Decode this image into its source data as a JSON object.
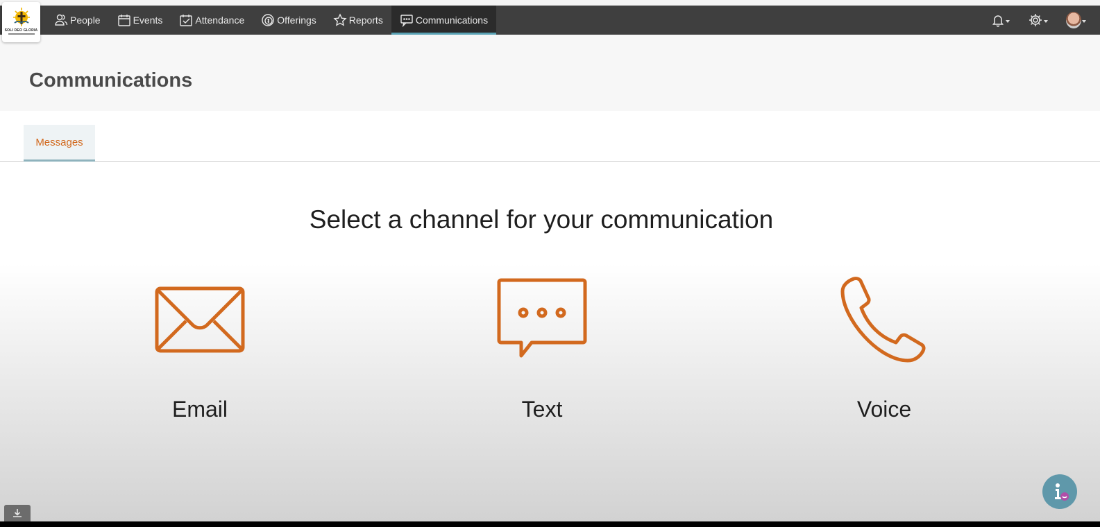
{
  "logo": {
    "text": "SOLI DEO GLORIA"
  },
  "nav": {
    "items": [
      {
        "label": "People",
        "icon": "people-icon"
      },
      {
        "label": "Events",
        "icon": "calendar-icon"
      },
      {
        "label": "Attendance",
        "icon": "checkbox-calendar-icon"
      },
      {
        "label": "Offerings",
        "icon": "coin-icon"
      },
      {
        "label": "Reports",
        "icon": "star-icon"
      },
      {
        "label": "Communications",
        "icon": "chat-bubble-icon",
        "active": true
      }
    ],
    "right_icons": [
      "bell-icon",
      "gear-icon",
      "avatar"
    ]
  },
  "page": {
    "title": "Communications"
  },
  "tabs": [
    {
      "label": "Messages",
      "active": true
    }
  ],
  "main": {
    "heading": "Select a channel for your communication",
    "channels": [
      {
        "label": "Email",
        "icon": "envelope-icon"
      },
      {
        "label": "Text",
        "icon": "speech-bubble-icon"
      },
      {
        "label": "Voice",
        "icon": "phone-icon"
      }
    ]
  },
  "colors": {
    "accent": "#d2691e",
    "navbar": "#3f3f3f",
    "active_underline": "#5aa3b5",
    "help_button": "#5f98aa"
  }
}
